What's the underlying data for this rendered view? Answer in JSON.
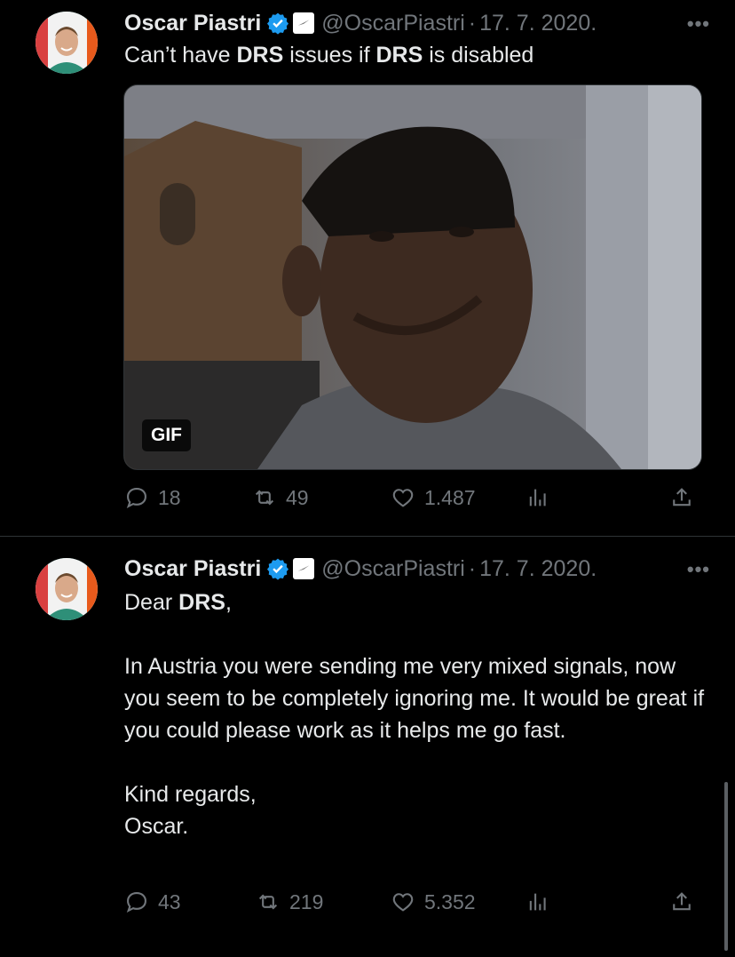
{
  "tweets": [
    {
      "author": "Oscar Piastri",
      "handle": "@OscarPiastri",
      "separator": "·",
      "date": "17. 7. 2020.",
      "text": [
        "Can’t have ",
        "DRS",
        " issues if ",
        "DRS",
        " is disabled"
      ],
      "media_badge": "GIF",
      "replies": "18",
      "retweets": "49",
      "likes": "1.487"
    },
    {
      "author": "Oscar Piastri",
      "handle": "@OscarPiastri",
      "separator": "·",
      "date": "17. 7. 2020.",
      "greeting_prefix": "Dear ",
      "greeting_bold": "DRS",
      "greeting_suffix": ",",
      "para1": "In Austria you were sending me very mixed signals, now you seem to be completely ignoring me. It would be great if you could please work as it helps me go fast.",
      "closing1": "Kind regards,",
      "closing2": "Oscar.",
      "replies": "43",
      "retweets": "219",
      "likes": "5.352"
    }
  ],
  "colors": {
    "background": "#000000",
    "text": "#e7e9ea",
    "muted": "#71767b",
    "verified": "#1d9bf0",
    "divider": "#2f3336"
  },
  "icons": [
    "more-icon",
    "verified-badge-icon",
    "affiliate-badge-icon",
    "reply-icon",
    "retweet-icon",
    "like-icon",
    "views-icon",
    "share-icon"
  ]
}
